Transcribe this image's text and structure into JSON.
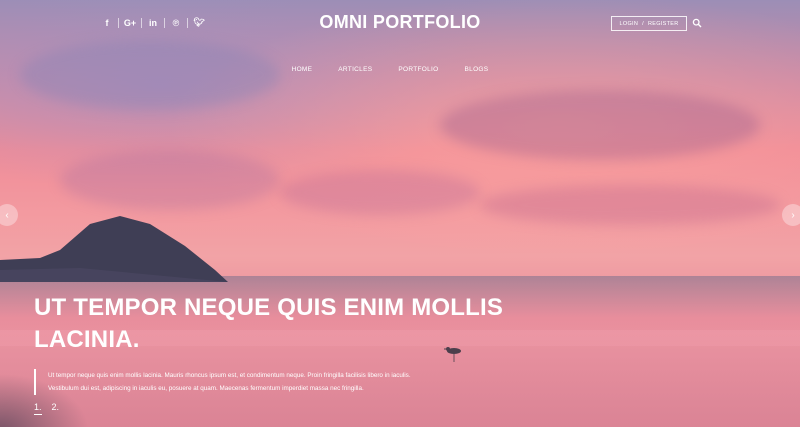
{
  "header": {
    "brand": "OMNI PORTFOLIO",
    "social": [
      {
        "icon": "facebook-icon",
        "glyph": "f"
      },
      {
        "icon": "google-plus-icon",
        "glyph": "G+"
      },
      {
        "icon": "linkedin-icon",
        "glyph": "in"
      },
      {
        "icon": "pinterest-icon",
        "glyph": "℗"
      },
      {
        "icon": "twitter-icon",
        "glyph": "🐦︎"
      }
    ],
    "login_label": "LOGIN",
    "auth_separator": "/",
    "register_label": "REGISTER",
    "search_icon": "search-icon"
  },
  "nav": {
    "items": [
      "HOME",
      "ARTICLES",
      "PORTFOLIO",
      "BLOGS"
    ]
  },
  "slider": {
    "prev_icon": "chevron-left-icon",
    "next_icon": "chevron-right-icon",
    "prev_glyph": "‹",
    "next_glyph": "›",
    "headline": "UT TEMPOR NEQUE QUIS ENIM MOLLIS LACINIA.",
    "description": "Ut tempor neque quis enim mollis lacinia. Mauris rhoncus ipsum est, et condimentum neque. Proin fringilla facilisis libero in iaculis. Vestibulum dui est, adipiscing in iaculis eu, posuere at quam. Maecenas fermentum imperdiet massa nec fringilla.",
    "pages": [
      "1.",
      "2."
    ],
    "active_page": 0
  },
  "colors": {
    "sky_top": "#9c8eb6",
    "sky_pink": "#f08c98",
    "text": "#ffffff"
  }
}
